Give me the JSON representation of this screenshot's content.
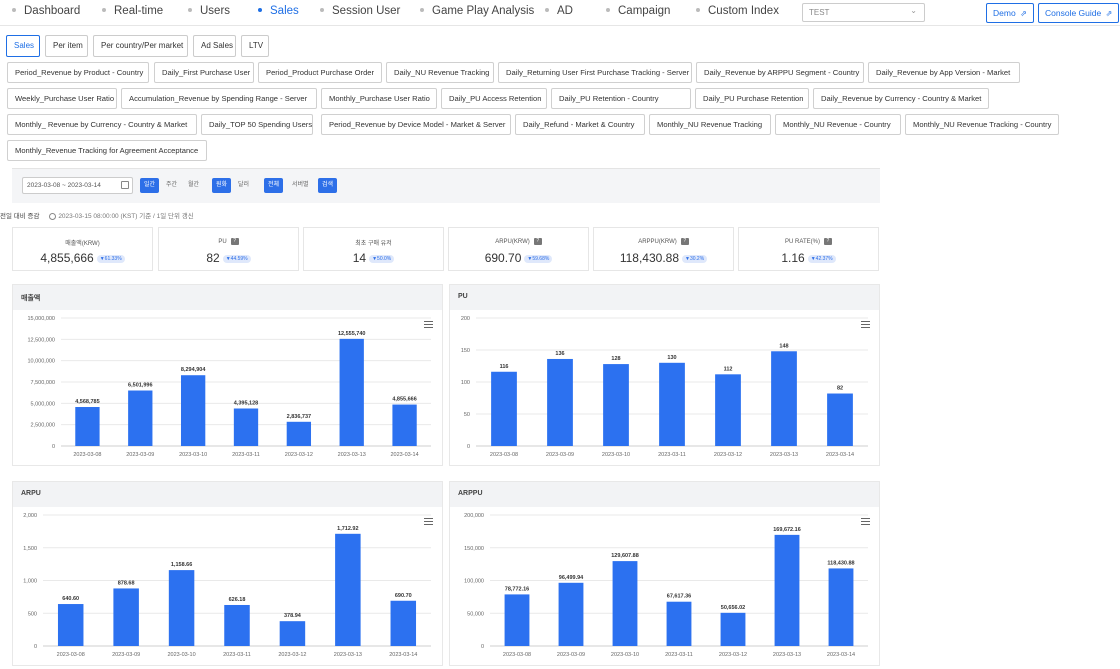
{
  "nav": {
    "items": [
      {
        "label": "Dashboard",
        "active": false
      },
      {
        "label": "Real-time",
        "active": false
      },
      {
        "label": "Users",
        "active": false
      },
      {
        "label": "Sales",
        "active": true
      },
      {
        "label": "Session User",
        "active": false
      },
      {
        "label": "Game Play Analysis",
        "active": false
      },
      {
        "label": "AD",
        "active": false
      },
      {
        "label": "Campaign",
        "active": false
      },
      {
        "label": "Custom Index",
        "active": false
      }
    ],
    "game_select": "TEST",
    "demo_label": "Demo",
    "guide_label": "Console Guide",
    "external_icon": "external-link-icon"
  },
  "subtabs": [
    {
      "label": "Sales",
      "active": true
    },
    {
      "label": "Per item",
      "active": false
    },
    {
      "label": "Per country/Per market",
      "active": false
    },
    {
      "label": "Ad Sales",
      "active": false
    },
    {
      "label": "LTV",
      "active": false
    }
  ],
  "reports": [
    "Period_Revenue by Product - Country",
    "Daily_First Purchase User",
    "Period_Product Purchase Order",
    "Daily_NU Revenue Tracking",
    "Daily_Returning User First Purchase Tracking - Server",
    "Daily_Revenue by ARPPU Segment - Country",
    "Daily_Revenue by App Version - Market",
    "Weekly_Purchase User Ratio",
    "Accumulation_Revenue by Spending Range - Server",
    "Monthly_Purchase User Ratio",
    "Daily_PU Access Retention",
    "Daily_PU Retention - Country",
    "Daily_PU Purchase Retention",
    "Daily_Revenue by Currency - Country & Market",
    "Monthly_ Revenue by Currency - Country & Market",
    "Daily_TOP 50 Spending Users",
    "Period_Revenue by Device Model - Market & Server",
    "Daily_Refund - Market & Country",
    "Monthly_NU Revenue Tracking",
    "Monthly_NU Revenue - Country",
    "Monthly_NU Revenue Tracking - Country",
    "Monthly_Revenue Tracking for Agreement Acceptance"
  ],
  "filter": {
    "date_range": "2023-03-08 ~ 2023-03-14",
    "calendar_icon": "calendar-icon",
    "period_buttons": [
      {
        "label": "일간",
        "on": true
      },
      {
        "label": "주간",
        "on": false
      },
      {
        "label": "월간",
        "on": false
      }
    ],
    "currency_buttons": [
      {
        "label": "원화",
        "on": true
      },
      {
        "label": "달러",
        "on": false
      }
    ],
    "scope_buttons": [
      {
        "label": "전체",
        "on": true
      },
      {
        "label": "서버별",
        "on": false
      }
    ],
    "search_label": "검색"
  },
  "summary": {
    "label": "전일 대비 증감",
    "timestamp": "2023-03-15 08:00:00 (KST) 기준 / 1일 단위 갱신"
  },
  "kpis": [
    {
      "label": "매출액(KRW)",
      "value": "4,855,666",
      "change": "▼61.33%",
      "help": false
    },
    {
      "label": "PU",
      "value": "82",
      "change": "▼44.59%",
      "help": true
    },
    {
      "label": "최초 구매 유저",
      "value": "14",
      "change": "▼50.0%",
      "help": false
    },
    {
      "label": "ARPU(KRW)",
      "value": "690.70",
      "change": "▼59.68%",
      "help": true
    },
    {
      "label": "ARPPU(KRW)",
      "value": "118,430.88",
      "change": "▼30.2%",
      "help": true
    },
    {
      "label": "PU RATE(%)",
      "value": "1.16",
      "change": "▼42.37%",
      "help": true
    }
  ],
  "chart_data": [
    {
      "type": "bar",
      "title": "매출액",
      "categories": [
        "2023-03-08",
        "2023-03-09",
        "2023-03-10",
        "2023-03-11",
        "2023-03-12",
        "2023-03-13",
        "2023-03-14"
      ],
      "values": [
        4568785,
        6501996,
        8294904,
        4395128,
        2836737,
        12555740,
        4855666
      ],
      "value_labels": [
        "4,568,785",
        "6,501,996",
        "8,294,904",
        "4,395,128",
        "2,836,737",
        "12,555,740",
        "4,855,666"
      ],
      "ylim": [
        0,
        15000000
      ],
      "yticks": [
        0,
        2500000,
        5000000,
        7500000,
        10000000,
        12500000,
        15000000
      ],
      "ytick_labels": [
        "0",
        "2,500,000",
        "5,000,000",
        "7,500,000",
        "10,000,000",
        "12,500,000",
        "15,000,000"
      ],
      "color": "#2c71f0",
      "grid": true
    },
    {
      "type": "bar",
      "title": "PU",
      "categories": [
        "2023-03-08",
        "2023-03-09",
        "2023-03-10",
        "2023-03-11",
        "2023-03-12",
        "2023-03-13",
        "2023-03-14"
      ],
      "values": [
        116,
        136,
        128,
        130,
        112,
        148,
        82
      ],
      "value_labels": [
        "116",
        "136",
        "128",
        "130",
        "112",
        "148",
        "82"
      ],
      "ylim": [
        0,
        200
      ],
      "yticks": [
        0,
        50,
        100,
        150,
        200
      ],
      "ytick_labels": [
        "0",
        "50",
        "100",
        "150",
        "200"
      ],
      "color": "#2c71f0",
      "grid": true
    },
    {
      "type": "bar",
      "title": "ARPU",
      "categories": [
        "2023-03-08",
        "2023-03-09",
        "2023-03-10",
        "2023-03-11",
        "2023-03-12",
        "2023-03-13",
        "2023-03-14"
      ],
      "values": [
        640.6,
        878.68,
        1158.66,
        626.18,
        378.94,
        1712.92,
        690.7
      ],
      "value_labels": [
        "640.60",
        "878.68",
        "1,158.66",
        "626.18",
        "378.94",
        "1,712.92",
        "690.70"
      ],
      "ylim": [
        0,
        2000
      ],
      "yticks": [
        0,
        500,
        1000,
        1500,
        2000
      ],
      "ytick_labels": [
        "0",
        "500",
        "1,000",
        "1,500",
        "2,000"
      ],
      "color": "#2c71f0",
      "grid": true
    },
    {
      "type": "bar",
      "title": "ARPPU",
      "categories": [
        "2023-03-08",
        "2023-03-09",
        "2023-03-10",
        "2023-03-11",
        "2023-03-12",
        "2023-03-13",
        "2023-03-14"
      ],
      "values": [
        78772.16,
        96499.94,
        129607.88,
        67617.36,
        50656.02,
        169672.16,
        118430.88
      ],
      "value_labels": [
        "78,772.16",
        "96,499.94",
        "129,607.88",
        "67,617.36",
        "50,656.02",
        "169,672.16",
        "118,430.88"
      ],
      "ylim": [
        0,
        200000
      ],
      "yticks": [
        0,
        50000,
        100000,
        150000,
        200000
      ],
      "ytick_labels": [
        "0",
        "50,000",
        "100,000",
        "150,000",
        "200,000"
      ],
      "color": "#2c71f0",
      "grid": true
    }
  ]
}
